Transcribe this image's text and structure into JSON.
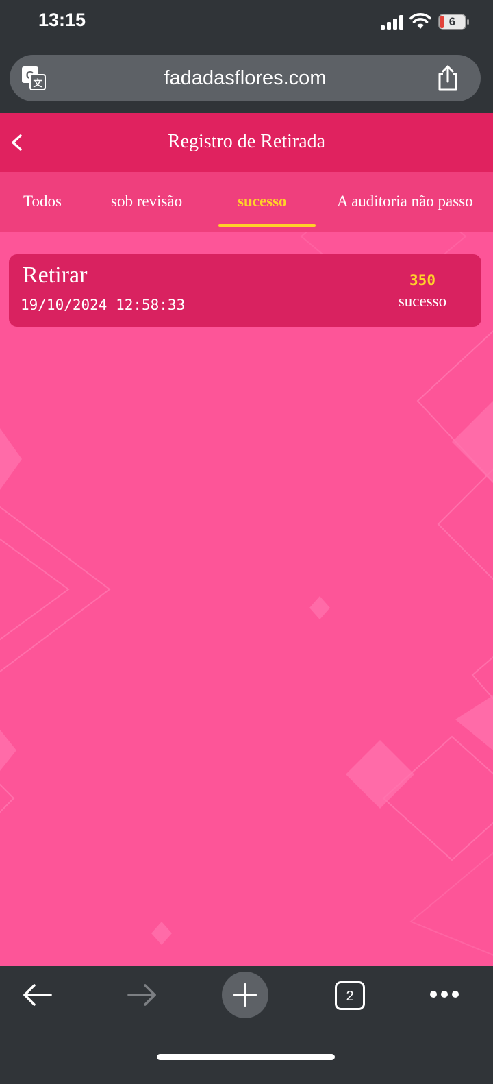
{
  "status_bar": {
    "time": "13:15",
    "battery_level": "6",
    "icons": [
      "cellular-signal-icon",
      "wifi-icon",
      "battery-icon"
    ]
  },
  "browser": {
    "url": "fadadasflores.com",
    "icons": [
      "translate-icon",
      "share-icon"
    ]
  },
  "page": {
    "title": "Registro de Retirada",
    "tabs": [
      {
        "label": "Todos",
        "active": false
      },
      {
        "label": "sob revisão",
        "active": false
      },
      {
        "label": "sucesso",
        "active": true
      },
      {
        "label": "A auditoria não passo",
        "active": false
      }
    ],
    "records": [
      {
        "title": "Retirar",
        "datetime": "19/10/2024 12:58:33",
        "amount": "350",
        "status": "sucesso"
      }
    ]
  },
  "toolbar": {
    "open_tabs_count": "2",
    "icons": [
      "back-arrow-icon",
      "forward-arrow-icon",
      "new-tab-plus-icon",
      "tabs-icon",
      "more-dots-icon"
    ]
  },
  "colors": {
    "header": "#e0225f",
    "tabs_bar": "#ef3f7d",
    "page_background": "#fd5598",
    "card": "#d92260",
    "accent_yellow": "#ffd12a",
    "browser_chrome": "#303438"
  }
}
